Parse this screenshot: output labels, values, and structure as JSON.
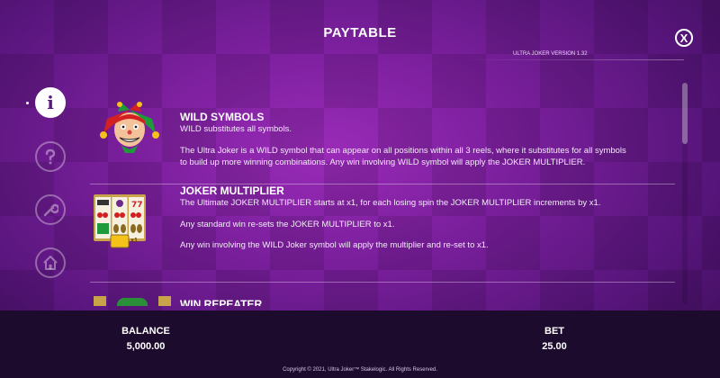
{
  "header": {
    "title": "PAYTABLE",
    "version": "ULTRA JOKER VERSION 1.32",
    "close_glyph": "X"
  },
  "side_menu": {
    "items": [
      {
        "name": "info",
        "glyph": "i",
        "active": true
      },
      {
        "name": "help",
        "glyph": "?",
        "active": false
      },
      {
        "name": "settings",
        "glyph": "wrench",
        "active": false
      },
      {
        "name": "home",
        "glyph": "home",
        "active": false
      }
    ]
  },
  "sections": [
    {
      "title": "WILD SYMBOLS",
      "lines": [
        "WILD substitutes all symbols.",
        "",
        "The Ultra Joker is a WILD symbol that can appear on all positions within all 3 reels, where it substitutes for all symbols",
        "to build up more winning combinations. Any win involving WILD symbol will apply the JOKER MULTIPLIER."
      ]
    },
    {
      "title": "JOKER MULTIPLIER",
      "lines": [
        "The Ultimate JOKER MULTIPLIER starts at x1, for each losing spin the JOKER MULTIPLIER increments by x1.",
        "",
        "Any standard win re-sets the JOKER MULTIPLIER to x1.",
        "",
        "Any win involving the WILD Joker symbol will apply the multiplier and re-set to x1."
      ],
      "thumb_badge": "x1"
    },
    {
      "title": "WIN REPEATER"
    }
  ],
  "footer": {
    "balance_label": "BALANCE",
    "balance_value": "5,000.00",
    "bet_label": "BET",
    "bet_value": "25.00",
    "copyright": "Copyright © 2021, Ultra Joker™ Stakelogic. All Rights Reserved."
  },
  "colors": {
    "bg_center": "#9a2bb8",
    "bg_edge": "#3a0d55",
    "footer_bg": "#1d0b2e"
  }
}
